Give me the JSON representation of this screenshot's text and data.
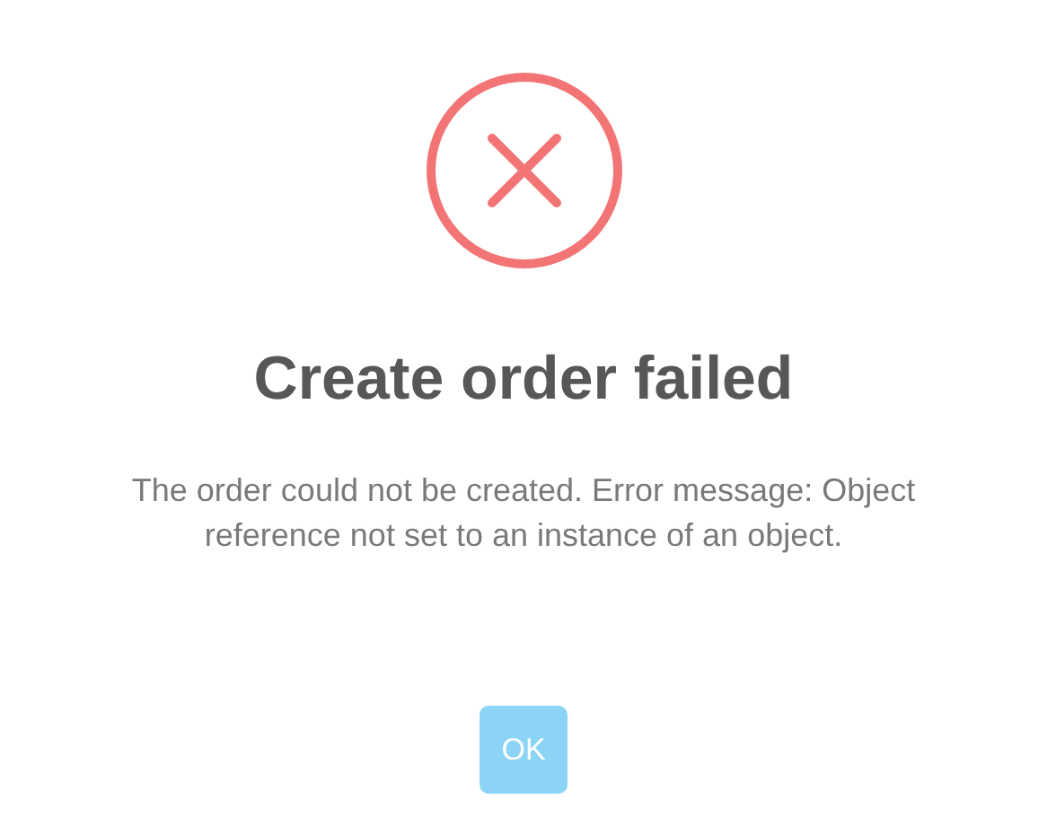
{
  "dialog": {
    "kind": "error",
    "title": "Create order failed",
    "message": "The order could not be created. Error message: Object reference not set to an instance of an object.",
    "buttons": [
      {
        "label": "OK",
        "disabled": true
      }
    ]
  }
}
